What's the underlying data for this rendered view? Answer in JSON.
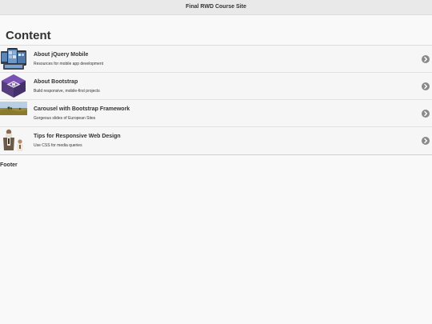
{
  "header": {
    "title": "Final RWD Course Site"
  },
  "main": {
    "title": "Content",
    "items": [
      {
        "title": "About jQuery Mobile",
        "subtitle": "Resources for mobile app development",
        "thumb_icon": "devices-thumbnail"
      },
      {
        "title": "About Bootstrap",
        "subtitle": "Build responsive, mobile-first projects",
        "thumb_icon": "bootstrap-logo"
      },
      {
        "title": "Carousel with Bootstrap Framework",
        "subtitle": "Gorgeous slides of European Sites",
        "thumb_icon": "landscape-thumbnail"
      },
      {
        "title": "Tips for Responsive Web Design",
        "subtitle": "Use CSS for media queries",
        "thumb_icon": "people-thumbnail"
      }
    ],
    "arrow_icon": "chevron-right-circle-icon"
  },
  "footer": {
    "text": "Footer"
  },
  "colors": {
    "header_bg": "#e9e9e9",
    "page_bg": "#f9f9f9",
    "list_bg": "#f6f6f6",
    "arrow_bg": "#8a8a8a",
    "bootstrap_purple": "#563d7c"
  }
}
